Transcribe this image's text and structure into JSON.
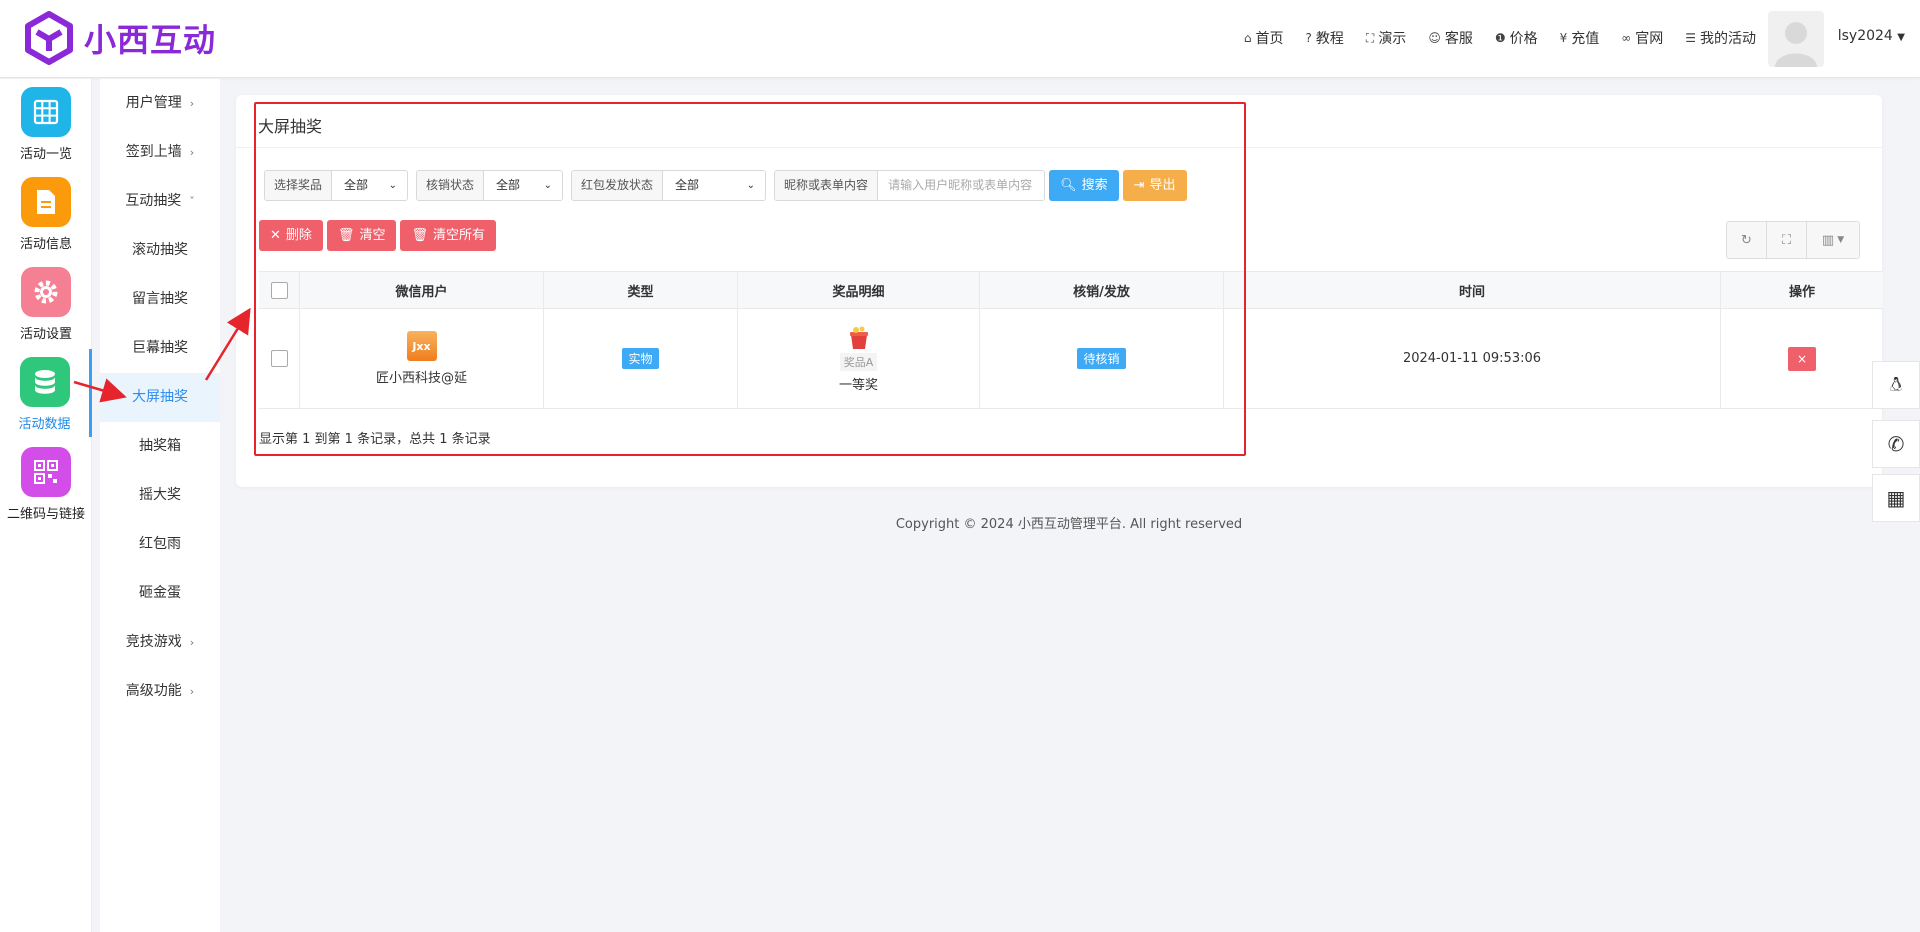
{
  "brand": {
    "name": "小西互动",
    "color": "#8b28d8"
  },
  "topnav": [
    {
      "icon": "home-icon",
      "glyph": "⌂",
      "label": "首页"
    },
    {
      "icon": "help-icon",
      "glyph": "?",
      "label": "教程"
    },
    {
      "icon": "fullscreen-icon",
      "glyph": "⛶",
      "label": "演示"
    },
    {
      "icon": "smile-icon",
      "glyph": "☺",
      "label": "客服"
    },
    {
      "icon": "info-icon",
      "glyph": "❶",
      "label": "价格"
    },
    {
      "icon": "yen-icon",
      "glyph": "¥",
      "label": "充值"
    },
    {
      "icon": "link-icon",
      "glyph": "∞",
      "label": "官网"
    },
    {
      "icon": "list-icon",
      "glyph": "☰",
      "label": "我的活动"
    }
  ],
  "user": {
    "name": "lsy2024"
  },
  "iconbar": [
    {
      "label": "活动一览",
      "icon": "grid-icon",
      "color": "#1fb5e8"
    },
    {
      "label": "活动信息",
      "icon": "document-icon",
      "color": "#fb9a0b"
    },
    {
      "label": "活动设置",
      "icon": "gear-icon",
      "color": "#f57f93"
    },
    {
      "label": "活动数据",
      "icon": "database-icon",
      "color": "#2ec77b"
    },
    {
      "label": "二维码与链接",
      "icon": "qrcode-icon",
      "color": "#d34ee8"
    }
  ],
  "submenu": {
    "user_mgmt": "用户管理",
    "signin": "签到上墙",
    "lottery": "互动抽奖",
    "items": [
      "滚动抽奖",
      "留言抽奖",
      "巨幕抽奖",
      "大屏抽奖",
      "抽奖箱",
      "摇大奖",
      "红包雨",
      "砸金蛋"
    ],
    "games": "竞技游戏",
    "advanced": "高级功能"
  },
  "card": {
    "title": "大屏抽奖"
  },
  "filters": {
    "prize_label": "选择奖品",
    "prize_value": "全部",
    "verify_label": "核销状态",
    "verify_value": "全部",
    "redpack_label": "红包发放状态",
    "redpack_value": "全部",
    "keyword_label": "昵称或表单内容",
    "keyword_placeholder": "请输入用户昵称或表单内容",
    "search_label": "搜索",
    "export_label": "导出"
  },
  "actions": {
    "delete_label": "删除",
    "clear_label": "清空",
    "clear_all_label": "清空所有"
  },
  "table": {
    "headers": {
      "user": "微信用户",
      "type": "类型",
      "prize": "奖品明细",
      "status": "核销/发放",
      "time": "时间",
      "op": "操作"
    },
    "rows": [
      {
        "avatar_text": "Jxx",
        "user": "匠小西科技@延",
        "type": "实物",
        "prize_item": "奖品A",
        "prize_level": "一等奖",
        "status": "待核销",
        "time": "2024-01-11 09:53:06",
        "op": "×"
      }
    ]
  },
  "pager": "显示第 1 到第 1 条记录，总共 1 条记录",
  "footer": "Copyright © 2024 小西互动管理平台. All right reserved",
  "colors": {
    "primary": "#3ea9f5",
    "danger": "#f0606b",
    "warning": "#f6ae4a",
    "annotation": "#e5242b"
  }
}
